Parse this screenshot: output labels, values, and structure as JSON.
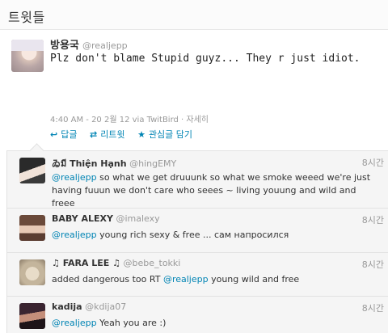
{
  "header": {
    "title": "트윗들"
  },
  "main_tweet": {
    "display_name": "방용국",
    "handle": "@realjepp",
    "text": "Plz don't blame Stupid guyz... They r just idiot.",
    "meta": "4:40 AM - 20 2월 12 via TwitBird · 자세히",
    "actions": [
      {
        "icon": "reply-arrow-icon",
        "glyph": "↩",
        "label": "답글"
      },
      {
        "icon": "retweet-icon",
        "glyph": "⇄",
        "label": "리트윗"
      },
      {
        "icon": "star-icon",
        "glyph": "★",
        "label": "관심글 담기"
      }
    ]
  },
  "replies": [
    {
      "display_name": "ゐมี Thiện Hạnh",
      "handle": "@hingEMY",
      "time": "8시간",
      "mention": "@realjepp",
      "text": " so what we get druuunk so what we smoke weeed we're just having fuuun we don't care who seees ~ living youung and wild and freee"
    },
    {
      "display_name": "BABY ALEXY",
      "handle": "@imalexy",
      "time": "8시간",
      "mention": "@realjepp",
      "text": " young rich sexy & free ... сам напросился"
    },
    {
      "display_name": "♫ FARA LEE ♫",
      "handle": "@bebe_tokki",
      "time": "8시간",
      "prefix": "added dangerous too RT ",
      "mention": "@realjepp",
      "text": " young wild and free"
    },
    {
      "display_name": "kadija",
      "handle": "@kdija07",
      "time": "8시간",
      "mention": "@realjepp",
      "text": " Yeah you are :)"
    }
  ]
}
